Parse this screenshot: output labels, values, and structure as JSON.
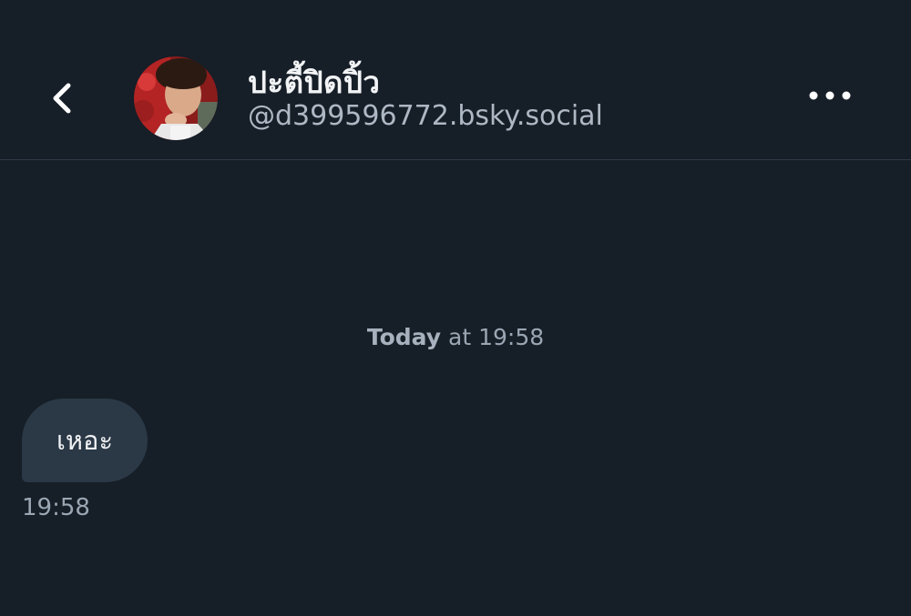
{
  "header": {
    "display_name": "ปะตี้ปิดปิ้ว",
    "handle": "@d399596772.bsky.social",
    "back_icon": "chevron-left-icon",
    "more_icon": "more-horizontal-icon"
  },
  "conversation": {
    "date_divider_bold": "Today",
    "date_divider_rest": " at 19:58",
    "messages": [
      {
        "text": "เหอะ",
        "time": "19:58"
      }
    ]
  },
  "colors": {
    "background": "#161e27",
    "bubble": "#2b3846",
    "muted_text": "#9aa6b3",
    "divider": "#2e3946"
  }
}
